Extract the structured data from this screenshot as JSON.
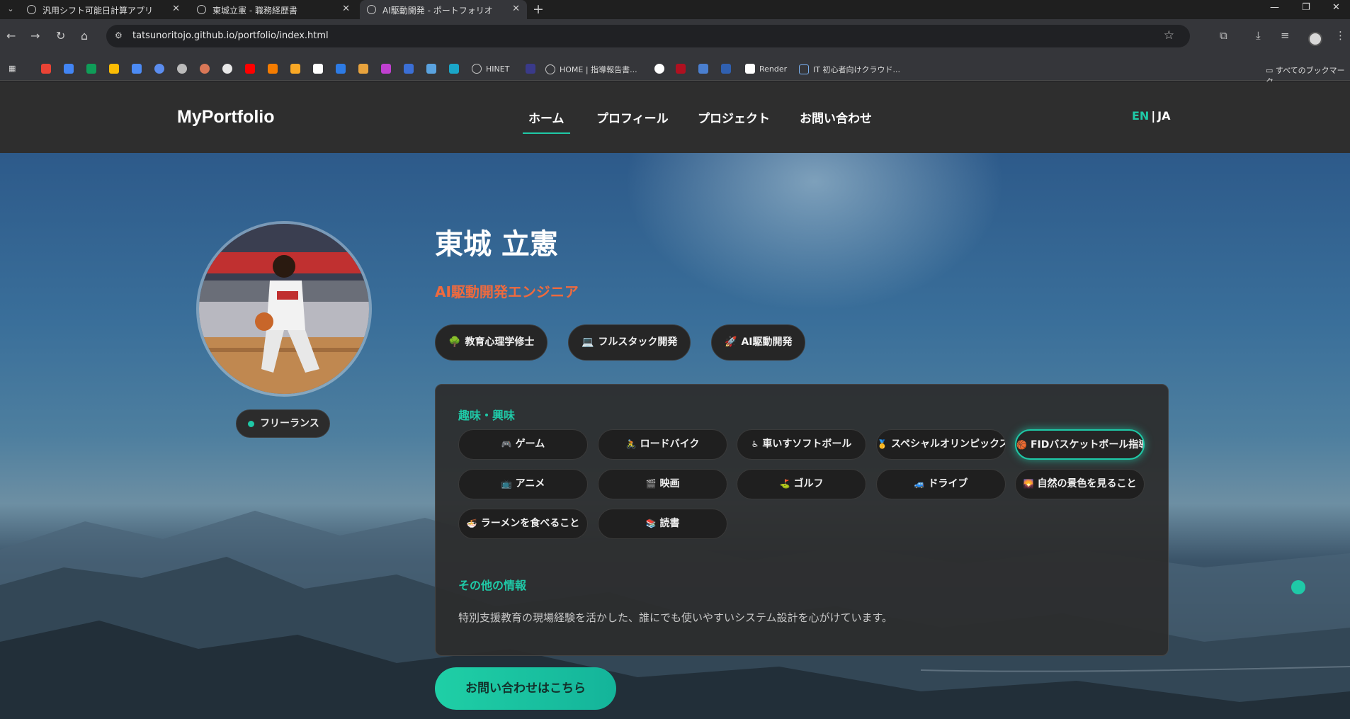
{
  "browser": {
    "tabs": [
      {
        "title": "汎用シフト可能日計算アプリ"
      },
      {
        "title": "東城立憲 - 職務経歴書"
      },
      {
        "title": "AI駆動開発 - ポートフォリオ"
      }
    ],
    "url": "tatsunoritojo.github.io/portfolio/index.html",
    "bookmarks": [
      {
        "label": "HINET"
      },
      {
        "label": "HOME | 指導報告書..."
      },
      {
        "label": "Render"
      },
      {
        "label": "IT 初心者向けクラウド..."
      }
    ],
    "bookmarks_folder": "すべてのブックマーク"
  },
  "site": {
    "logo": "MyPortfolio",
    "nav": [
      {
        "label": "ホーム"
      },
      {
        "label": "プロフィール"
      },
      {
        "label": "プロジェクト"
      },
      {
        "label": "お問い合わせ"
      }
    ],
    "lang": {
      "en": "EN",
      "sep": "|",
      "ja": "JA"
    }
  },
  "profile": {
    "name": "東城 立憲",
    "role": "AI駆動開発エンジニア",
    "status": "フリーランス",
    "skills": [
      {
        "icon": "tree-icon",
        "glyph": "🌳",
        "label": "教育心理学修士"
      },
      {
        "icon": "laptop-icon",
        "glyph": "💻",
        "label": "フルスタック開発"
      },
      {
        "icon": "rocket-icon",
        "glyph": "🚀",
        "label": "AI駆動開発"
      }
    ]
  },
  "hobbies": {
    "heading": "趣味・興味",
    "items": [
      {
        "icon": "gamepad-icon",
        "glyph": "🎮",
        "label": "ゲーム"
      },
      {
        "icon": "bicycle-icon",
        "glyph": "🚴",
        "label": "ロードバイク"
      },
      {
        "icon": "wheelchair-icon",
        "glyph": "♿",
        "label": "車いすソフトボール"
      },
      {
        "icon": "medal-icon",
        "glyph": "🥇",
        "label": "スペシャルオリンピックス"
      },
      {
        "icon": "basketball-icon",
        "glyph": "🏀",
        "label": "FIDバスケットボール指導"
      },
      {
        "icon": "tv-icon",
        "glyph": "📺",
        "label": "アニメ"
      },
      {
        "icon": "film-icon",
        "glyph": "🎬",
        "label": "映画"
      },
      {
        "icon": "golf-icon",
        "glyph": "⛳",
        "label": "ゴルフ"
      },
      {
        "icon": "car-icon",
        "glyph": "🚙",
        "label": "ドライブ"
      },
      {
        "icon": "landscape-icon",
        "glyph": "🌄",
        "label": "自然の景色を見ること"
      },
      {
        "icon": "ramen-icon",
        "glyph": "🍜",
        "label": "ラーメンを食べること"
      },
      {
        "icon": "books-icon",
        "glyph": "📚",
        "label": "読書"
      }
    ]
  },
  "other": {
    "heading": "その他の情報",
    "text": "特別支援教育の現場経験を活かした、誰にでも使いやすいシステム設計を心がけています。"
  },
  "cta": {
    "label": "お問い合わせはこちら"
  },
  "colors": {
    "accent": "#1fc9a7",
    "role": "#ef6a3e",
    "header_bg": "#2e2e2e"
  }
}
